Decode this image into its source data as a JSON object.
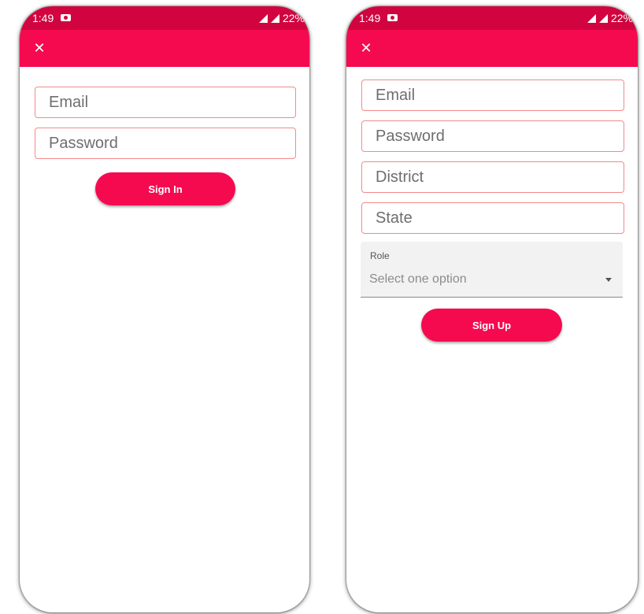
{
  "status_bar": {
    "left_time": "1:49",
    "left_battery": "22%",
    "right_time": "1:49",
    "right_battery": "22%"
  },
  "sign_in": {
    "close_icon": "close-icon",
    "email_placeholder": "Email",
    "password_placeholder": "Password",
    "button_label": "Sign In"
  },
  "sign_up": {
    "close_icon": "close-icon",
    "email_placeholder": "Email",
    "password_placeholder": "Password",
    "district_placeholder": "District",
    "state_placeholder": "State",
    "role": {
      "label": "Role",
      "value": "Select one option"
    },
    "button_label": "Sign Up"
  },
  "colors": {
    "accent": "#f50a4f",
    "status_bar": "#d1043f",
    "field_border": "#f28a8a"
  }
}
